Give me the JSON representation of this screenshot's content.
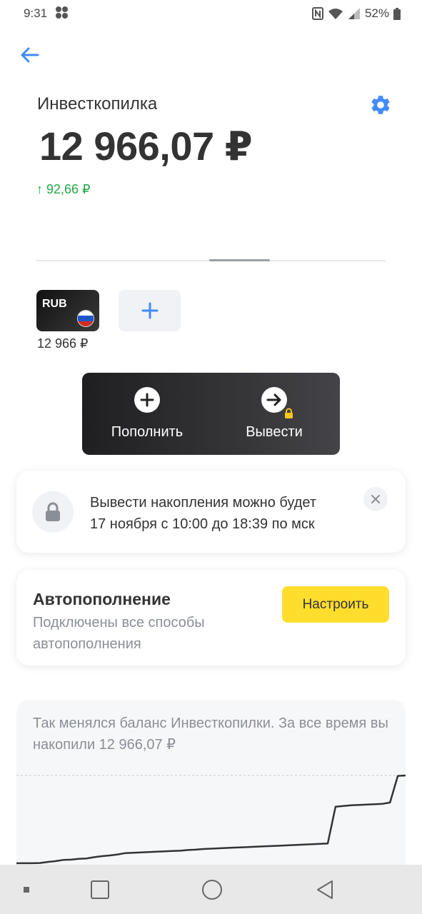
{
  "status_bar": {
    "time": "9:31",
    "battery": "52%"
  },
  "header": {
    "title": "Инвесткопилка",
    "balance": "12 966,07 ₽",
    "delta": "↑ 92,66 ₽"
  },
  "currencies": [
    {
      "code": "RUB",
      "amount": "12 966 ₽"
    }
  ],
  "actions": {
    "deposit_label": "Пополнить",
    "withdraw_label": "Вывести"
  },
  "notice": {
    "line1": "Вывести накопления можно будет",
    "line2": "17 ноября с 10:00 до 18:39 по мск"
  },
  "autodeposit": {
    "title": "Автопополнение",
    "subtitle": "Подключены все способы автопополнения",
    "button_label": "Настроить"
  },
  "chart": {
    "caption": "Так менялся баланс Инвесткопилки. За все время вы накопили 12 966,07 ₽"
  },
  "chart_data": {
    "type": "line",
    "title": "",
    "xlabel": "",
    "ylabel": "",
    "x": [
      0,
      2,
      4,
      6,
      8,
      10,
      12,
      14,
      16,
      18,
      20,
      22,
      24,
      26,
      28,
      30,
      32,
      34,
      36,
      38,
      40,
      42,
      44,
      46,
      48,
      50,
      52,
      54,
      56,
      58,
      60,
      62,
      64,
      66,
      68,
      70,
      72,
      74,
      76,
      78,
      80,
      82,
      84,
      86,
      88,
      90,
      92,
      94,
      96,
      98,
      100
    ],
    "y": [
      120,
      120,
      120,
      150,
      300,
      420,
      600,
      640,
      760,
      820,
      1000,
      1150,
      1250,
      1400,
      1600,
      1650,
      1700,
      1750,
      1800,
      1850,
      1900,
      1950,
      2050,
      2100,
      2200,
      2250,
      2300,
      2350,
      2400,
      2450,
      2500,
      2550,
      2600,
      2650,
      2700,
      2750,
      2800,
      2850,
      2900,
      2950,
      3000,
      8400,
      8500,
      8600,
      8650,
      8700,
      8750,
      8800,
      9000,
      12900,
      12966
    ],
    "ylim": [
      0,
      12966
    ],
    "grid": false,
    "colors": {
      "line": "#333333",
      "reference": "#c8c8c8"
    }
  },
  "colors": {
    "accent_blue": "#428bf9",
    "positive_green": "#22a845",
    "yellow_button": "#ffdd2d"
  }
}
